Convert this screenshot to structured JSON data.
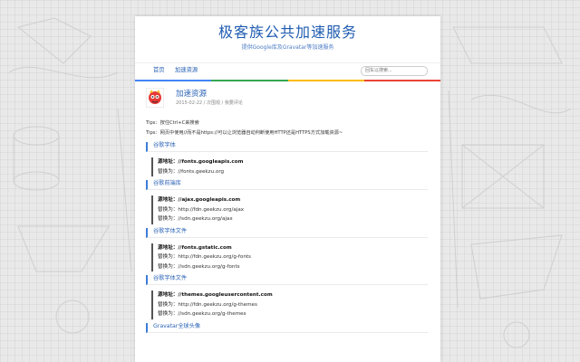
{
  "site": {
    "title": "极客族公共加速服务",
    "subtitle": "提供Google库及Gravatar等加速服务"
  },
  "nav": {
    "items": [
      "首页",
      "加速资源"
    ],
    "search_placeholder": "回车以搜索..."
  },
  "post": {
    "title": "加速资源",
    "meta": {
      "date": "2015-02-22",
      "sep1": " / ",
      "views": "次围观",
      "sep2": " / ",
      "comment": "我要评论"
    },
    "tips": [
      "Tips：按住Ctrl+C来搜索",
      "Tips：网页中使用//而不是https://可以让浏览器自动判断使用HTTP还是HTTPS方式加载资源~"
    ]
  },
  "sections": [
    {
      "title": "谷歌字体",
      "source_label": "源地址：",
      "source": "//fonts.googleapis.com",
      "replacements": [
        {
          "label": "替换为：",
          "value": "//fonts.geekzu.org"
        }
      ]
    },
    {
      "title": "谷歌前端库",
      "source_label": "源地址：",
      "source": "//ajax.googleapis.com",
      "replacements": [
        {
          "label": "替换为：",
          "value": "http://fdn.geekzu.org/ajax"
        },
        {
          "label": "替换为：",
          "value": "//sdn.geekzu.org/ajax"
        }
      ]
    },
    {
      "title": "谷歌字体文件",
      "source_label": "源地址：",
      "source": "//fonts.gstatic.com",
      "replacements": [
        {
          "label": "替换为：",
          "value": "http://fdn.geekzu.org/g-fonts"
        },
        {
          "label": "替换为：",
          "value": "//sdn.geekzu.org/g-fonts"
        }
      ]
    },
    {
      "title": "谷歌字体文件",
      "source_label": "源地址：",
      "source": "//themes.googleusercontent.com",
      "replacements": [
        {
          "label": "替换为：",
          "value": "http://fdn.geekzu.org/g-themes"
        },
        {
          "label": "替换为：",
          "value": "//sdn.geekzu.org/g-themes"
        }
      ]
    },
    {
      "title": "Gravatar全球头像"
    }
  ],
  "colors": {
    "accent": "#2a62b5",
    "title": "#1e5bb0",
    "google_blue": "#4285f4",
    "google_green": "#34a853",
    "google_yellow": "#fbbc05",
    "google_red": "#ea4335"
  }
}
